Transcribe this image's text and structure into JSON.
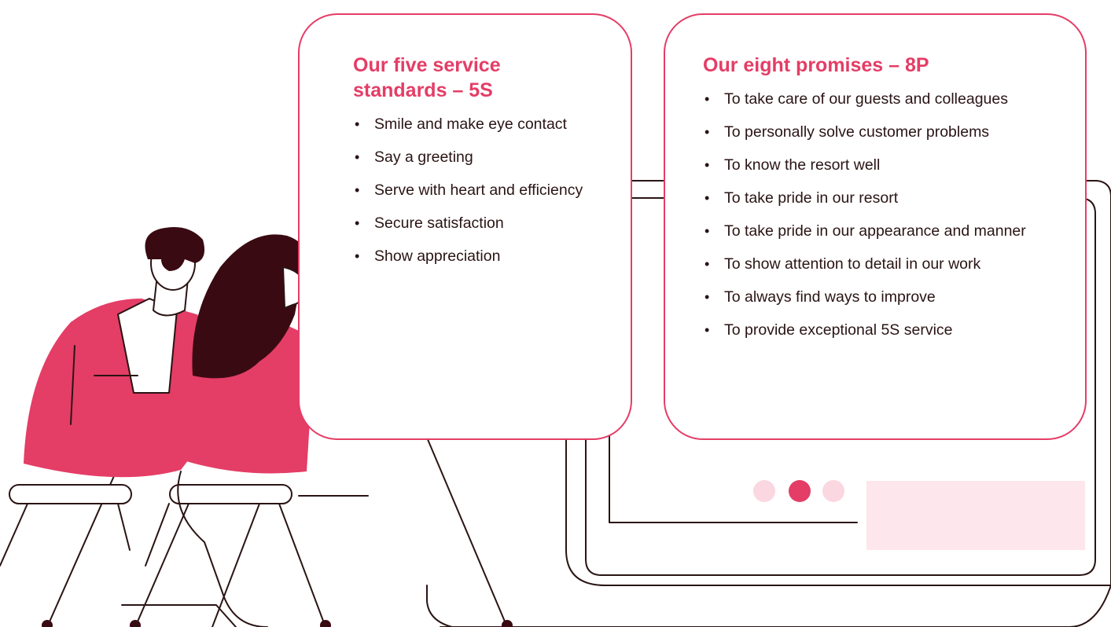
{
  "colors": {
    "accent": "#e43d66",
    "accent_light": "#fde6ec",
    "dark": "#3a0a12",
    "line": "#2a1414"
  },
  "illustration": {
    "people": "two-people-at-desk-pointing",
    "device": "laptop-outline",
    "carousel_dots": 3,
    "carousel_active_index": 1
  },
  "five_standards": {
    "title": "Our five service standards – 5S",
    "items": [
      "Smile and make eye contact",
      "Say a greeting",
      "Serve with heart and efficiency",
      "Secure satisfaction",
      "Show appreciation"
    ]
  },
  "eight_promises": {
    "title": "Our eight promises – 8P",
    "items": [
      "To take care of our guests and colleagues",
      "To personally solve customer problems",
      "To know the resort well",
      "To take pride in our resort",
      "To take pride in our appearance and manner",
      "To show attention to detail in our work",
      "To always find ways to improve",
      "To provide exceptional 5S service"
    ]
  }
}
